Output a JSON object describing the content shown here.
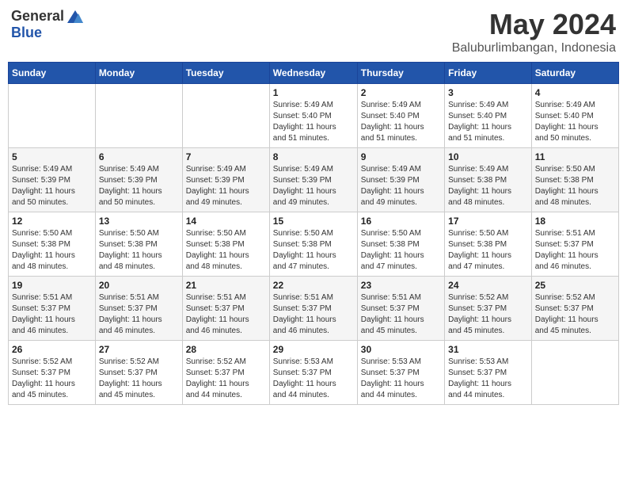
{
  "header": {
    "logo": {
      "general": "General",
      "blue": "Blue"
    },
    "title": "May 2024",
    "location": "Baluburlimbangan, Indonesia"
  },
  "weekdays": [
    "Sunday",
    "Monday",
    "Tuesday",
    "Wednesday",
    "Thursday",
    "Friday",
    "Saturday"
  ],
  "weeks": [
    [
      {
        "day": "",
        "info": ""
      },
      {
        "day": "",
        "info": ""
      },
      {
        "day": "",
        "info": ""
      },
      {
        "day": "1",
        "info": "Sunrise: 5:49 AM\nSunset: 5:40 PM\nDaylight: 11 hours\nand 51 minutes."
      },
      {
        "day": "2",
        "info": "Sunrise: 5:49 AM\nSunset: 5:40 PM\nDaylight: 11 hours\nand 51 minutes."
      },
      {
        "day": "3",
        "info": "Sunrise: 5:49 AM\nSunset: 5:40 PM\nDaylight: 11 hours\nand 51 minutes."
      },
      {
        "day": "4",
        "info": "Sunrise: 5:49 AM\nSunset: 5:40 PM\nDaylight: 11 hours\nand 50 minutes."
      }
    ],
    [
      {
        "day": "5",
        "info": "Sunrise: 5:49 AM\nSunset: 5:39 PM\nDaylight: 11 hours\nand 50 minutes."
      },
      {
        "day": "6",
        "info": "Sunrise: 5:49 AM\nSunset: 5:39 PM\nDaylight: 11 hours\nand 50 minutes."
      },
      {
        "day": "7",
        "info": "Sunrise: 5:49 AM\nSunset: 5:39 PM\nDaylight: 11 hours\nand 49 minutes."
      },
      {
        "day": "8",
        "info": "Sunrise: 5:49 AM\nSunset: 5:39 PM\nDaylight: 11 hours\nand 49 minutes."
      },
      {
        "day": "9",
        "info": "Sunrise: 5:49 AM\nSunset: 5:39 PM\nDaylight: 11 hours\nand 49 minutes."
      },
      {
        "day": "10",
        "info": "Sunrise: 5:49 AM\nSunset: 5:38 PM\nDaylight: 11 hours\nand 48 minutes."
      },
      {
        "day": "11",
        "info": "Sunrise: 5:50 AM\nSunset: 5:38 PM\nDaylight: 11 hours\nand 48 minutes."
      }
    ],
    [
      {
        "day": "12",
        "info": "Sunrise: 5:50 AM\nSunset: 5:38 PM\nDaylight: 11 hours\nand 48 minutes."
      },
      {
        "day": "13",
        "info": "Sunrise: 5:50 AM\nSunset: 5:38 PM\nDaylight: 11 hours\nand 48 minutes."
      },
      {
        "day": "14",
        "info": "Sunrise: 5:50 AM\nSunset: 5:38 PM\nDaylight: 11 hours\nand 48 minutes."
      },
      {
        "day": "15",
        "info": "Sunrise: 5:50 AM\nSunset: 5:38 PM\nDaylight: 11 hours\nand 47 minutes."
      },
      {
        "day": "16",
        "info": "Sunrise: 5:50 AM\nSunset: 5:38 PM\nDaylight: 11 hours\nand 47 minutes."
      },
      {
        "day": "17",
        "info": "Sunrise: 5:50 AM\nSunset: 5:38 PM\nDaylight: 11 hours\nand 47 minutes."
      },
      {
        "day": "18",
        "info": "Sunrise: 5:51 AM\nSunset: 5:37 PM\nDaylight: 11 hours\nand 46 minutes."
      }
    ],
    [
      {
        "day": "19",
        "info": "Sunrise: 5:51 AM\nSunset: 5:37 PM\nDaylight: 11 hours\nand 46 minutes."
      },
      {
        "day": "20",
        "info": "Sunrise: 5:51 AM\nSunset: 5:37 PM\nDaylight: 11 hours\nand 46 minutes."
      },
      {
        "day": "21",
        "info": "Sunrise: 5:51 AM\nSunset: 5:37 PM\nDaylight: 11 hours\nand 46 minutes."
      },
      {
        "day": "22",
        "info": "Sunrise: 5:51 AM\nSunset: 5:37 PM\nDaylight: 11 hours\nand 46 minutes."
      },
      {
        "day": "23",
        "info": "Sunrise: 5:51 AM\nSunset: 5:37 PM\nDaylight: 11 hours\nand 45 minutes."
      },
      {
        "day": "24",
        "info": "Sunrise: 5:52 AM\nSunset: 5:37 PM\nDaylight: 11 hours\nand 45 minutes."
      },
      {
        "day": "25",
        "info": "Sunrise: 5:52 AM\nSunset: 5:37 PM\nDaylight: 11 hours\nand 45 minutes."
      }
    ],
    [
      {
        "day": "26",
        "info": "Sunrise: 5:52 AM\nSunset: 5:37 PM\nDaylight: 11 hours\nand 45 minutes."
      },
      {
        "day": "27",
        "info": "Sunrise: 5:52 AM\nSunset: 5:37 PM\nDaylight: 11 hours\nand 45 minutes."
      },
      {
        "day": "28",
        "info": "Sunrise: 5:52 AM\nSunset: 5:37 PM\nDaylight: 11 hours\nand 44 minutes."
      },
      {
        "day": "29",
        "info": "Sunrise: 5:53 AM\nSunset: 5:37 PM\nDaylight: 11 hours\nand 44 minutes."
      },
      {
        "day": "30",
        "info": "Sunrise: 5:53 AM\nSunset: 5:37 PM\nDaylight: 11 hours\nand 44 minutes."
      },
      {
        "day": "31",
        "info": "Sunrise: 5:53 AM\nSunset: 5:37 PM\nDaylight: 11 hours\nand 44 minutes."
      },
      {
        "day": "",
        "info": ""
      }
    ]
  ]
}
